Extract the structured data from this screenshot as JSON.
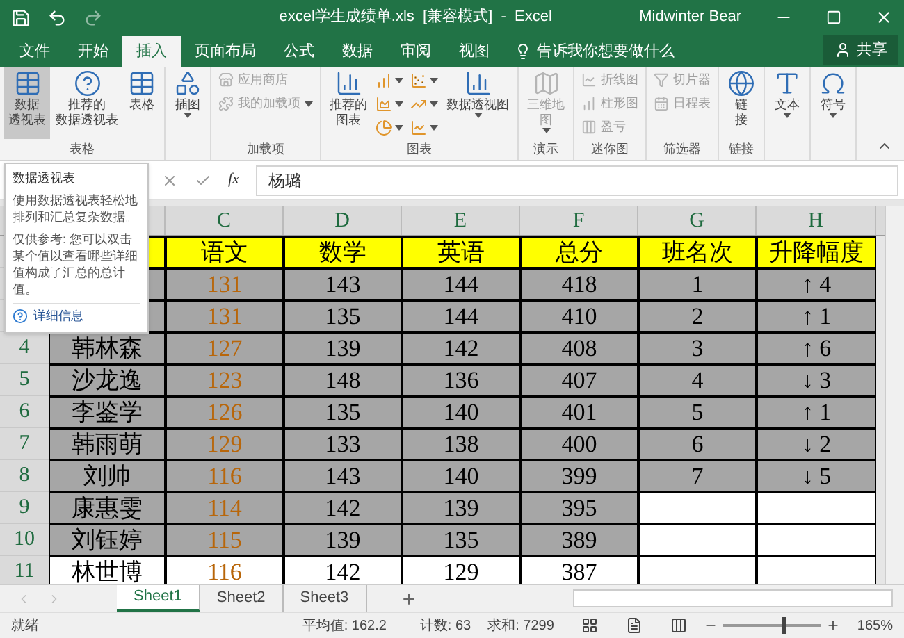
{
  "title_bar": {
    "title": "excel学生成绩单.xls  [兼容模式]  -  Excel",
    "user": "Midwinter Bear"
  },
  "tabs": [
    {
      "label": "文件",
      "selected": false
    },
    {
      "label": "开始",
      "selected": false
    },
    {
      "label": "插入",
      "selected": true
    },
    {
      "label": "页面布局",
      "selected": false
    },
    {
      "label": "公式",
      "selected": false
    },
    {
      "label": "数据",
      "selected": false
    },
    {
      "label": "审阅",
      "selected": false
    },
    {
      "label": "视图",
      "selected": false
    }
  ],
  "tell_me": "告诉我你想要做什么",
  "share": "共享",
  "ribbon_groups": [
    {
      "label": "表格",
      "items": [
        {
          "kind": "large",
          "lines": [
            "数据",
            "透视表"
          ],
          "disabled": false,
          "dropdown": false,
          "highlighted": true
        },
        {
          "kind": "large",
          "lines": [
            "推荐的",
            "数据透视表"
          ],
          "disabled": false,
          "dropdown": false,
          "highlighted": false
        },
        {
          "kind": "large",
          "lines": [
            "表格"
          ],
          "disabled": false,
          "dropdown": false,
          "highlighted": false
        }
      ]
    },
    {
      "items": [
        {
          "kind": "large",
          "lines": [
            "插图"
          ],
          "disabled": false,
          "dropdown": true,
          "highlighted": false
        }
      ]
    },
    {
      "label": "加载项",
      "items": [
        {
          "kind": "small",
          "lines": [
            "应用商店"
          ],
          "disabled": true,
          "dropdown": false,
          "highlighted": false
        },
        {
          "kind": "small",
          "lines": [
            "我的加载项"
          ],
          "disabled": true,
          "dropdown": true,
          "highlighted": false
        }
      ]
    },
    {
      "label": "图表",
      "items": [
        {
          "kind": "large",
          "lines": [
            "推荐的",
            "图表"
          ],
          "disabled": false,
          "dropdown": false,
          "highlighted": false
        },
        {
          "kind": "icon",
          "disabled": false,
          "dropdown": true,
          "highlighted": false
        },
        {
          "kind": "icon",
          "disabled": false,
          "dropdown": true,
          "highlighted": false
        },
        {
          "kind": "icon",
          "disabled": false,
          "dropdown": true,
          "highlighted": false
        },
        {
          "kind": "icon",
          "disabled": false,
          "dropdown": true,
          "highlighted": false
        },
        {
          "kind": "icon",
          "disabled": false,
          "dropdown": true,
          "highlighted": false
        },
        {
          "kind": "icon",
          "disabled": false,
          "dropdown": true,
          "highlighted": false
        },
        {
          "kind": "large",
          "lines": [
            "数据透视图"
          ],
          "disabled": false,
          "dropdown": true,
          "highlighted": false
        }
      ]
    },
    {
      "label": "演示",
      "items": [
        {
          "kind": "large",
          "lines": [
            "三维地",
            "图"
          ],
          "disabled": true,
          "dropdown": true,
          "highlighted": false
        }
      ]
    },
    {
      "label": "迷你图",
      "items": [
        {
          "kind": "small",
          "lines": [
            "折线图"
          ],
          "disabled": true,
          "dropdown": false,
          "highlighted": false
        },
        {
          "kind": "small",
          "lines": [
            "柱形图"
          ],
          "disabled": true,
          "dropdown": false,
          "highlighted": false
        },
        {
          "kind": "small",
          "lines": [
            "盈亏"
          ],
          "disabled": true,
          "dropdown": false,
          "highlighted": false
        }
      ]
    },
    {
      "label": "筛选器",
      "items": [
        {
          "kind": "small",
          "lines": [
            "切片器"
          ],
          "disabled": true,
          "dropdown": false,
          "highlighted": false
        },
        {
          "kind": "small",
          "lines": [
            "日程表"
          ],
          "disabled": true,
          "dropdown": false,
          "highlighted": false
        }
      ]
    },
    {
      "label": "链接",
      "items": [
        {
          "kind": "large",
          "lines": [
            "链",
            "接"
          ],
          "disabled": false,
          "dropdown": false,
          "highlighted": false
        }
      ]
    },
    {
      "items": [
        {
          "kind": "large",
          "lines": [
            "文本"
          ],
          "disabled": false,
          "dropdown": true,
          "highlighted": false
        }
      ]
    },
    {
      "items": [
        {
          "kind": "large",
          "lines": [
            "符号"
          ],
          "disabled": false,
          "dropdown": true,
          "highlighted": false
        }
      ]
    }
  ],
  "tooltip": {
    "title": "数据透视表",
    "body": "使用数据透视表轻松地排列和汇总复杂数据。",
    "note": "仅供参考: 您可以双击某个值以查看哪些详细值构成了汇总的总计值。",
    "link": "详细信息"
  },
  "formula_bar": {
    "fx": "fx",
    "value": "杨璐"
  },
  "columns": [
    "C",
    "D",
    "E",
    "F",
    "G",
    "H"
  ],
  "rows": [
    {
      "kind": "header",
      "cells": [
        "语文",
        "数学",
        "英语",
        "总分",
        "班名次",
        "升降幅度"
      ]
    },
    {
      "kind": "data",
      "selected": true,
      "cells": [
        "131",
        "143",
        "144",
        "418",
        "1",
        "↑ 4"
      ]
    },
    {
      "kind": "data",
      "selected": true,
      "cells": [
        "131",
        "135",
        "144",
        "410",
        "2",
        "↑ 1"
      ]
    },
    {
      "kind": "data",
      "selected": true,
      "number": "4",
      "name": "韩林森",
      "cells": [
        "127",
        "139",
        "142",
        "408",
        "3",
        "↑ 6"
      ]
    },
    {
      "kind": "data",
      "selected": true,
      "number": "5",
      "name": "沙龙逸",
      "cells": [
        "123",
        "148",
        "136",
        "407",
        "4",
        "↓ 3"
      ]
    },
    {
      "kind": "data",
      "selected": true,
      "number": "6",
      "name": "李鉴学",
      "cells": [
        "126",
        "135",
        "140",
        "401",
        "5",
        "↑ 1"
      ]
    },
    {
      "kind": "data",
      "selected": true,
      "number": "7",
      "name": "韩雨萌",
      "cells": [
        "129",
        "133",
        "138",
        "400",
        "6",
        "↓ 2"
      ]
    },
    {
      "kind": "data",
      "selected": true,
      "number": "8",
      "name": "刘帅",
      "cells": [
        "116",
        "143",
        "140",
        "399",
        "7",
        "↓ 5"
      ]
    },
    {
      "kind": "data",
      "selected": true,
      "number": "9",
      "name": "康惠雯",
      "cells": [
        "114",
        "142",
        "139",
        "395"
      ]
    },
    {
      "kind": "data",
      "selected": true,
      "number": "10",
      "name": "刘钰婷",
      "cells": [
        "115",
        "139",
        "135",
        "389"
      ]
    },
    {
      "kind": "data",
      "selected": false,
      "number": "11",
      "name": "林世博",
      "cells": [
        "116",
        "142",
        "129",
        "387"
      ]
    }
  ],
  "sheets": [
    {
      "label": "Sheet1",
      "selected": true
    },
    {
      "label": "Sheet2",
      "selected": false
    },
    {
      "label": "Sheet3",
      "selected": false
    }
  ],
  "status_bar": {
    "state": "就绪",
    "average": "平均值: 162.2",
    "count": "计数: 63",
    "sum": "求和: 7299",
    "zoom": "165%",
    "level": 0.6
  }
}
